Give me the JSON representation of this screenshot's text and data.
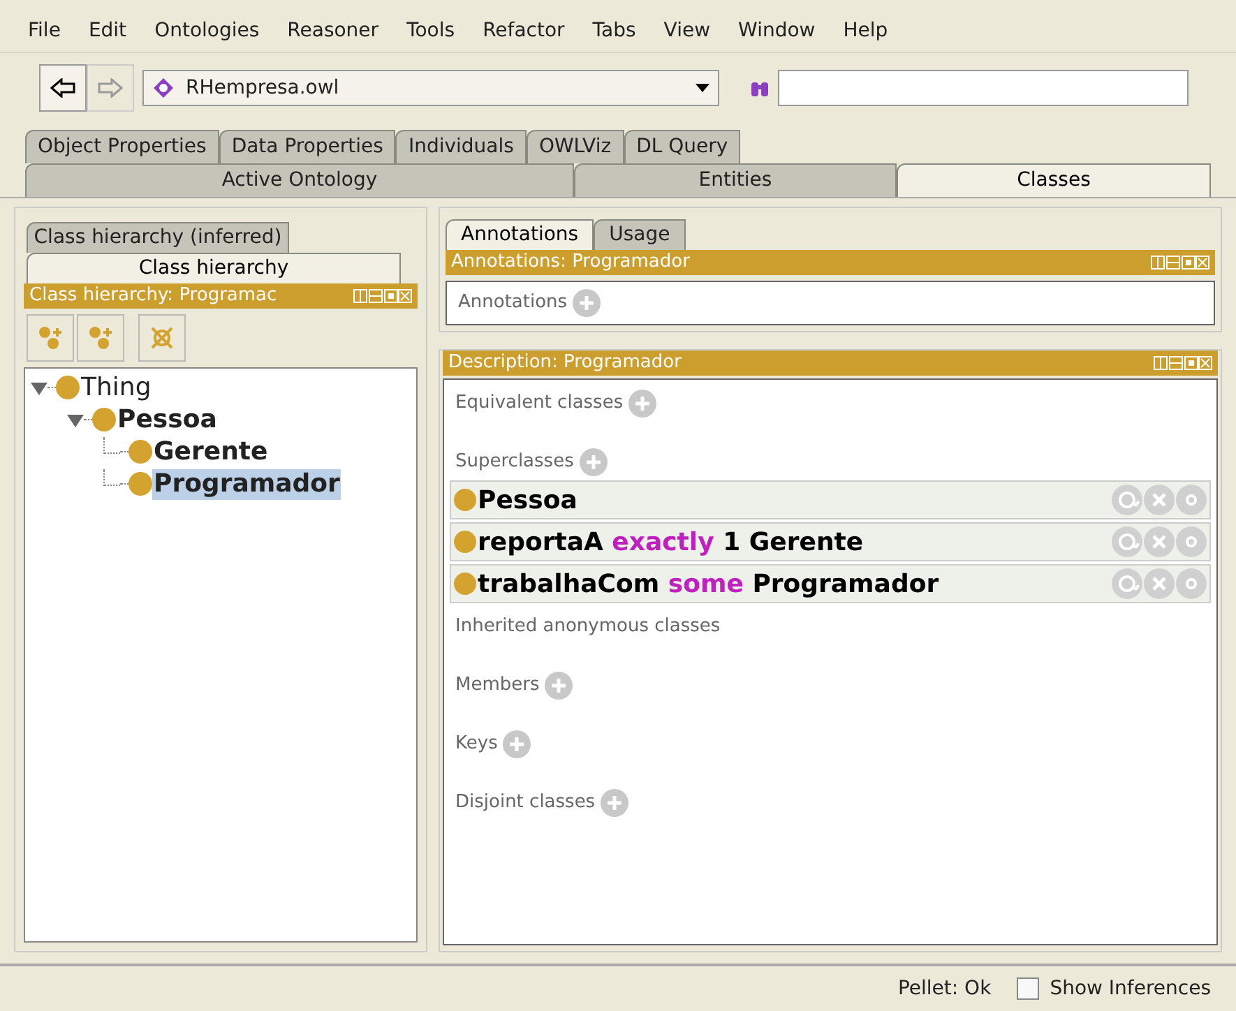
{
  "menu": [
    "File",
    "Edit",
    "Ontologies",
    "Reasoner",
    "Tools",
    "Refactor",
    "Tabs",
    "View",
    "Window",
    "Help"
  ],
  "ontology_selector": {
    "value": "RHempresa.owl"
  },
  "tab_rows": [
    [
      {
        "label": "Object Properties",
        "selected": false
      },
      {
        "label": "Data Properties",
        "selected": false
      },
      {
        "label": "Individuals",
        "selected": false
      },
      {
        "label": "OWLViz",
        "selected": false
      },
      {
        "label": "DL Query",
        "selected": false
      }
    ],
    [
      {
        "label": "Active Ontology",
        "selected": false
      },
      {
        "label": "Entities",
        "selected": false
      },
      {
        "label": "Classes",
        "selected": true
      }
    ]
  ],
  "left": {
    "tabs": [
      {
        "label": "Class hierarchy (inferred)",
        "selected": false
      },
      {
        "label": "Class hierarchy",
        "selected": true
      }
    ],
    "title": "Class hierarchy: Programac",
    "tree": [
      {
        "label": "Thing",
        "bold": false,
        "expanded": true,
        "selected": false,
        "children": [
          {
            "label": "Pessoa",
            "bold": true,
            "expanded": true,
            "selected": false,
            "children": [
              {
                "label": "Gerente",
                "bold": true,
                "selected": false
              },
              {
                "label": "Programador",
                "bold": true,
                "selected": true
              }
            ]
          }
        ]
      }
    ]
  },
  "right": {
    "tabs": [
      {
        "label": "Annotations",
        "selected": true
      },
      {
        "label": "Usage",
        "selected": false
      }
    ],
    "annotations_title": "Annotations: Programador",
    "annotations_label": "Annotations",
    "description_title": "Description: Programador",
    "sections": [
      {
        "label": "Equivalent classes",
        "addable": true
      },
      {
        "label": "Superclasses",
        "addable": true,
        "expressions": [
          {
            "tokens": [
              {
                "text": "Pessoa",
                "kind": "entity"
              }
            ]
          },
          {
            "tokens": [
              {
                "text": "reportaA",
                "kind": "entity"
              },
              {
                "text": "exactly",
                "kind": "keyword"
              },
              {
                "text": "1",
                "kind": "entity"
              },
              {
                "text": "Gerente",
                "kind": "entity"
              }
            ]
          },
          {
            "tokens": [
              {
                "text": "trabalhaCom",
                "kind": "entity"
              },
              {
                "text": "some",
                "kind": "keyword"
              },
              {
                "text": "Programador",
                "kind": "entity"
              }
            ]
          }
        ]
      },
      {
        "label": "Inherited anonymous classes",
        "addable": false
      },
      {
        "label": "Members",
        "addable": true
      },
      {
        "label": "Keys",
        "addable": true
      },
      {
        "label": "Disjoint classes",
        "addable": true
      }
    ]
  },
  "status": {
    "reasoner": "Pellet: Ok",
    "show_inferences": {
      "label": "Show Inferences",
      "checked": false
    }
  }
}
